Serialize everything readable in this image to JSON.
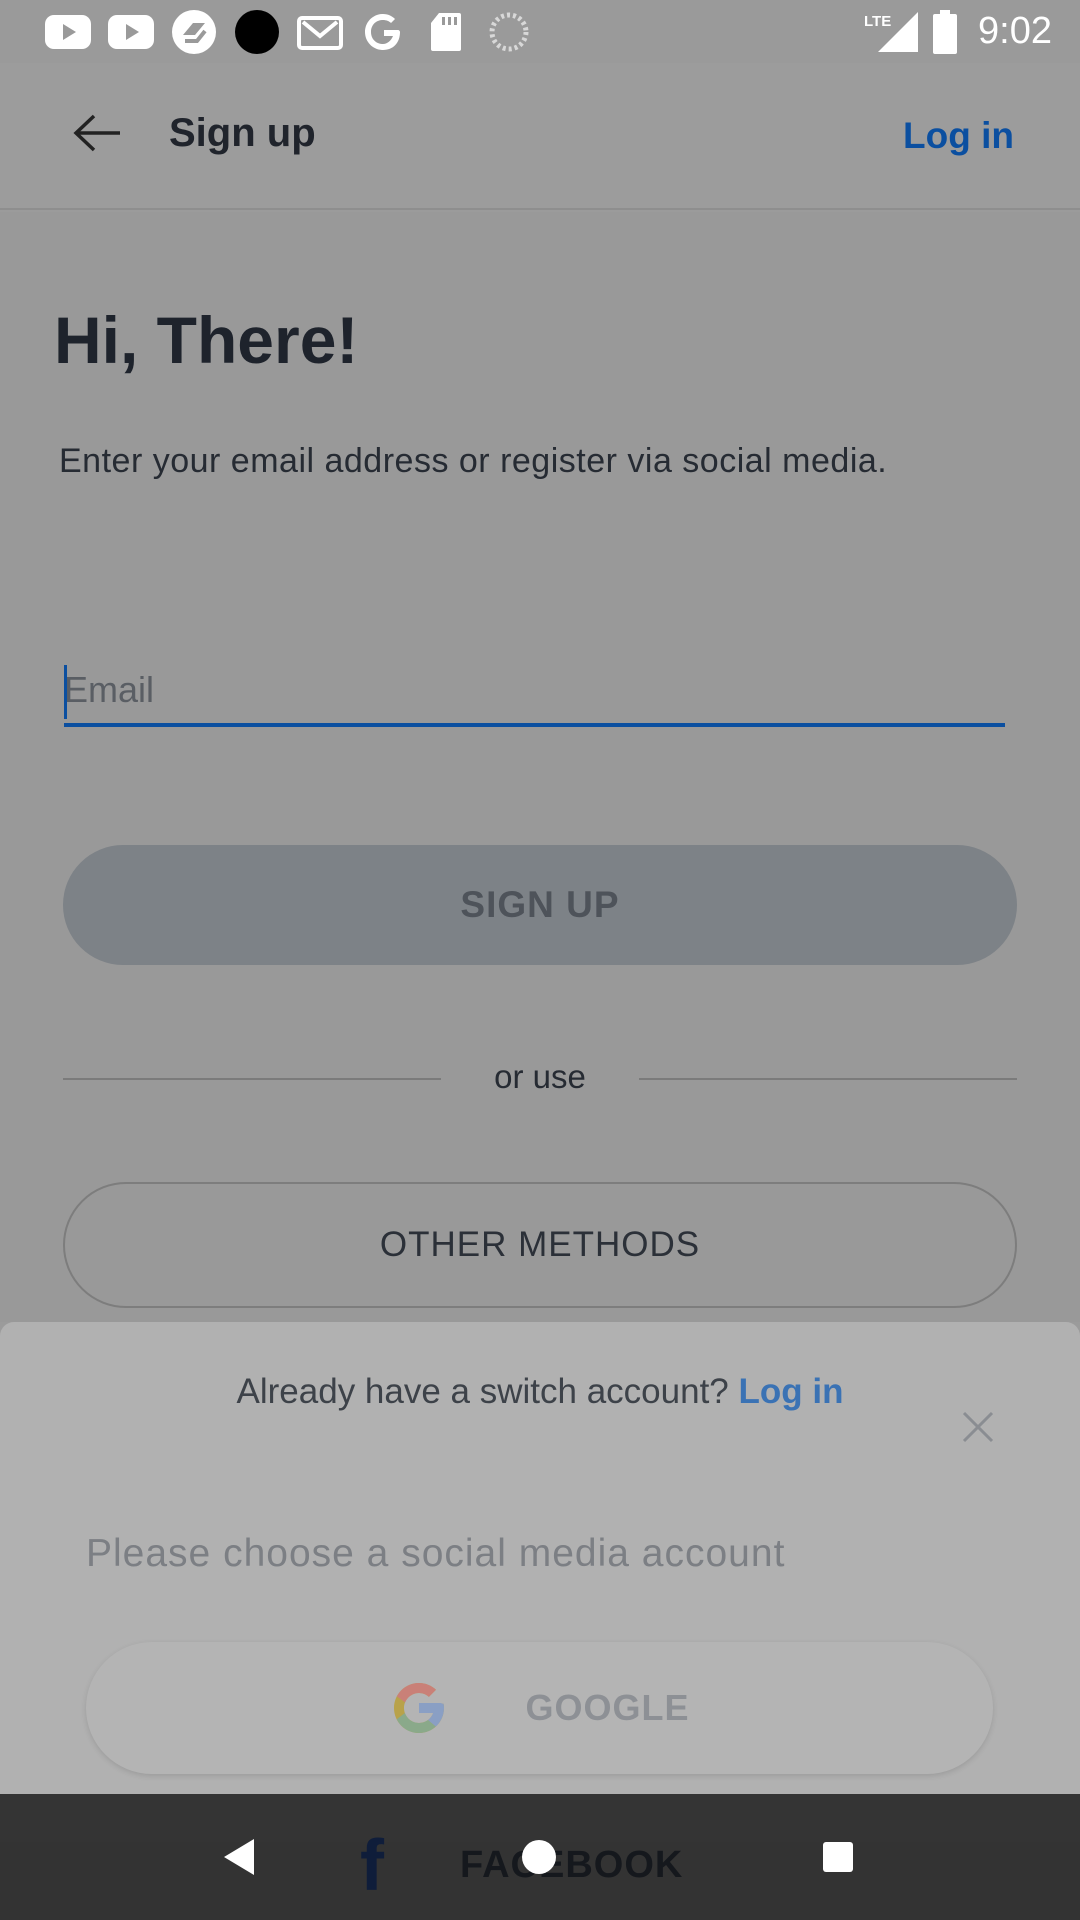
{
  "status_bar": {
    "time": "9:02",
    "network": "LTE",
    "left_icons": [
      "youtube-icon",
      "youtube-icon",
      "app-icon",
      "circle-app-icon",
      "gmail-icon",
      "google-icon",
      "sd-card-icon",
      "loading-icon"
    ],
    "right_icons": [
      "lte-signal-icon",
      "battery-icon"
    ]
  },
  "app_bar": {
    "title": "Sign up",
    "login_label": "Log in"
  },
  "main": {
    "greeting": "Hi, There!",
    "subtitle": "Enter your email address or register via social media.",
    "email_placeholder": "Email",
    "signup_label": "SIGN UP",
    "divider_text": "or use",
    "other_methods_label": "OTHER METHODS"
  },
  "sheet": {
    "prompt_text": "Already have a switch account?",
    "prompt_link": "Log in",
    "hint": "Please choose a social media account",
    "google_label": "GOOGLE",
    "facebook_label": "FACEBOOK",
    "facebook_glyph": "f"
  },
  "colors": {
    "accent": "#0b4fa0",
    "link_sheet": "#3a72b4",
    "scrim": "#9b9b9b"
  }
}
